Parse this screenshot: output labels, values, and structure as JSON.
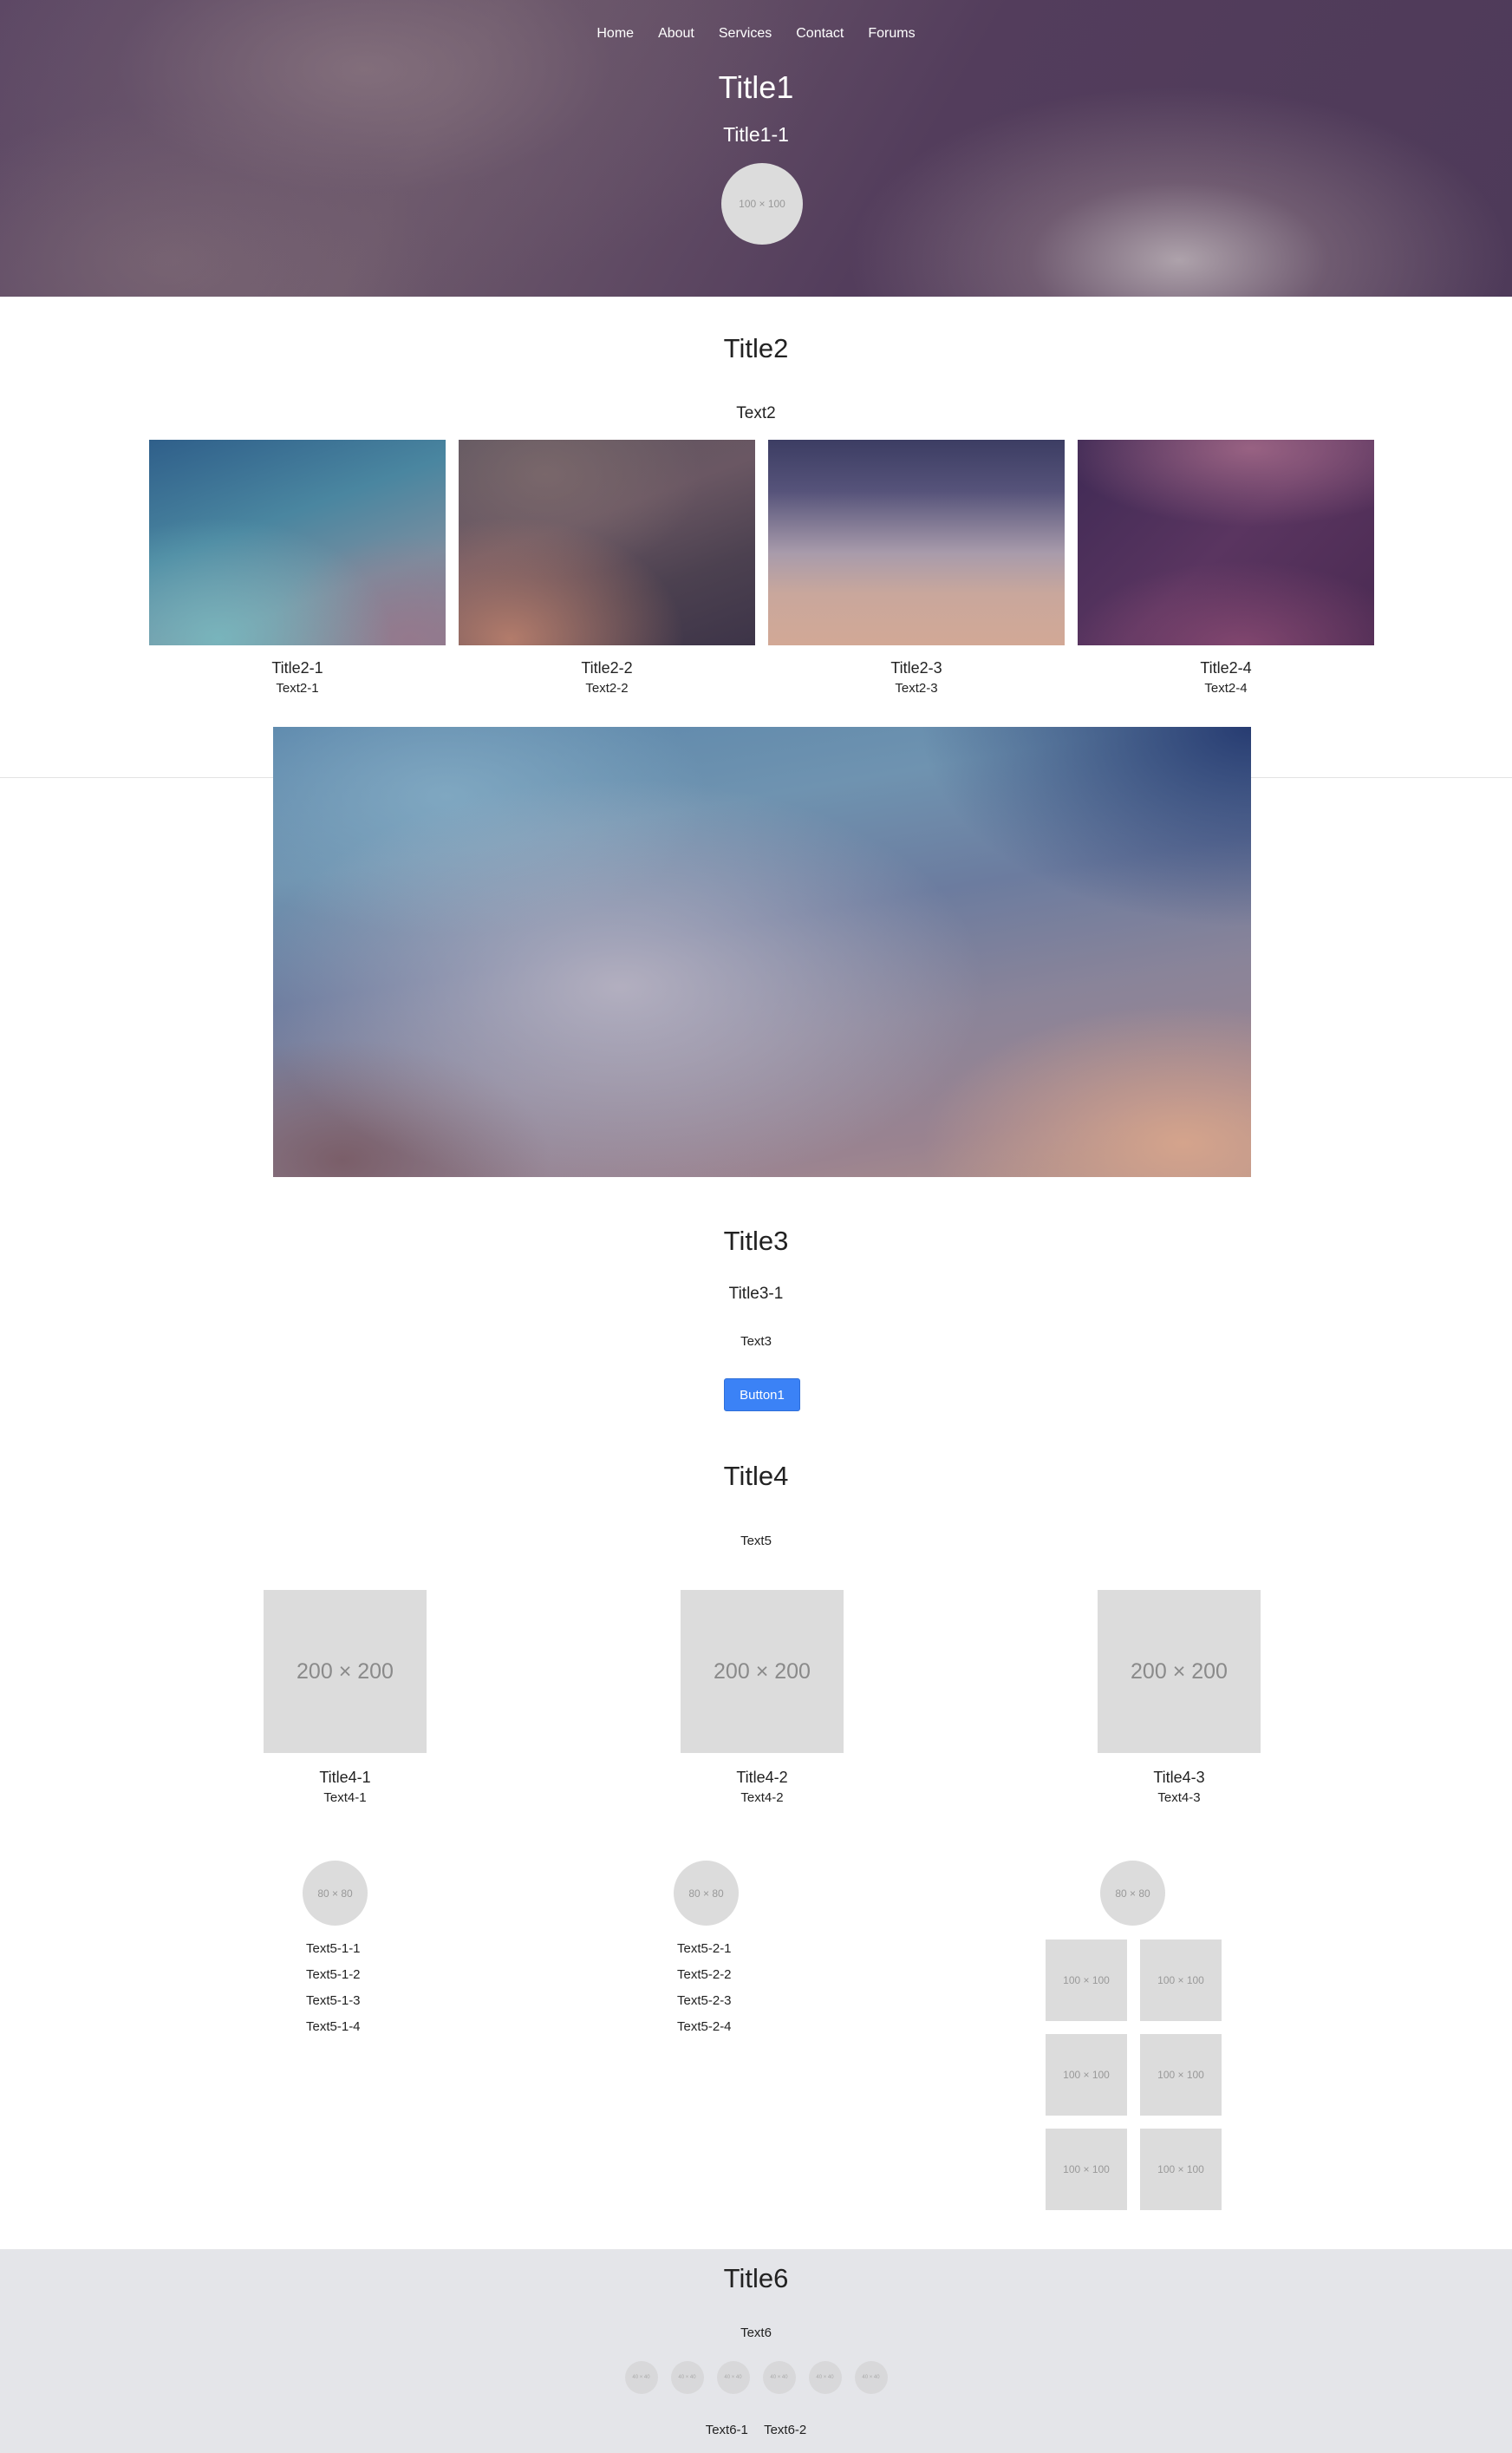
{
  "nav": [
    "Home",
    "About",
    "Services",
    "Contact",
    "Forums"
  ],
  "hero": {
    "title": "Title1",
    "subtitle": "Title1-1",
    "avatar": "100 × 100"
  },
  "section2": {
    "title": "Title2",
    "text": "Text2",
    "cards": [
      {
        "title": "Title2-1",
        "text": "Text2-1"
      },
      {
        "title": "Title2-2",
        "text": "Text2-2"
      },
      {
        "title": "Title2-3",
        "text": "Text2-3"
      },
      {
        "title": "Title2-4",
        "text": "Text2-4"
      }
    ]
  },
  "section3": {
    "title": "Title3",
    "subtitle": "Title3-1",
    "text": "Text3",
    "button": "Button1"
  },
  "section4": {
    "title": "Title4",
    "text": "Text5",
    "features": [
      {
        "image": "200 × 200",
        "title": "Title4-1",
        "text": "Text4-1"
      },
      {
        "image": "200 × 200",
        "title": "Title4-2",
        "text": "Text4-2"
      },
      {
        "image": "200 × 200",
        "title": "Title4-3",
        "text": "Text4-3"
      }
    ]
  },
  "section5": {
    "avatars": [
      "80 × 80",
      "80 × 80",
      "80 × 80"
    ],
    "list1": [
      "Text5-1-1",
      "Text5-1-2",
      "Text5-1-3",
      "Text5-1-4"
    ],
    "list2": [
      "Text5-2-1",
      "Text5-2-2",
      "Text5-2-3",
      "Text5-2-4"
    ],
    "thumbs": [
      "100 × 100",
      "100 × 100",
      "100 × 100",
      "100 × 100",
      "100 × 100",
      "100 × 100"
    ]
  },
  "footer": {
    "title": "Title6",
    "text": "Text6",
    "social": [
      "40 × 40",
      "40 × 40",
      "40 × 40",
      "40 × 40",
      "40 × 40",
      "40 × 40"
    ],
    "links": [
      "Text6-1",
      "Text6-2"
    ]
  },
  "colors": {
    "button": "#3b82f6",
    "footer_bg": "#e4e5e9",
    "placeholder": "#dcdcdc"
  }
}
